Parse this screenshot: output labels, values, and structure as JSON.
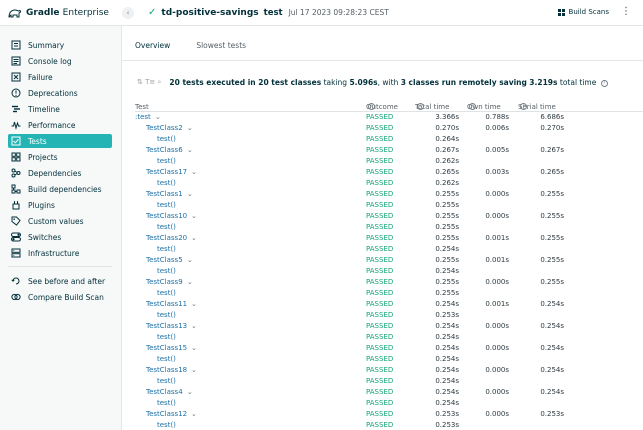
{
  "header": {
    "brand_bold": "Gradle",
    "brand_light": "Enterprise",
    "project": "td-positive-savings",
    "task": "test",
    "date": "Jul 17 2023 09:28:23 CEST",
    "build_scans_label": "Build Scans"
  },
  "sidebar": {
    "items": [
      {
        "label": "Summary",
        "icon": "summary-icon"
      },
      {
        "label": "Console log",
        "icon": "console-icon"
      },
      {
        "label": "Failure",
        "icon": "failure-icon"
      },
      {
        "label": "Deprecations",
        "icon": "deprecations-icon"
      },
      {
        "label": "Timeline",
        "icon": "timeline-icon"
      },
      {
        "label": "Performance",
        "icon": "performance-icon"
      },
      {
        "label": "Tests",
        "icon": "tests-icon"
      },
      {
        "label": "Projects",
        "icon": "projects-icon"
      },
      {
        "label": "Dependencies",
        "icon": "dependencies-icon"
      },
      {
        "label": "Build dependencies",
        "icon": "build-dependencies-icon"
      },
      {
        "label": "Plugins",
        "icon": "plugins-icon"
      },
      {
        "label": "Custom values",
        "icon": "custom-values-icon"
      },
      {
        "label": "Switches",
        "icon": "switches-icon"
      },
      {
        "label": "Infrastructure",
        "icon": "infrastructure-icon"
      }
    ],
    "active_item": "Tests",
    "secondary": [
      {
        "label": "See before and after",
        "icon": "before-after-icon"
      },
      {
        "label": "Compare Build Scan",
        "icon": "compare-icon"
      }
    ]
  },
  "tabs": [
    {
      "label": "Overview",
      "active": true
    },
    {
      "label": "Slowest tests",
      "active": false
    }
  ],
  "summary": {
    "count_text": "20 tests executed in 20 test classes",
    "taking_word": "taking",
    "duration": "5.096s",
    "with_word": ", with",
    "classes_text": "3 classes run remotely saving",
    "saving": "3.219s",
    "total_word": "total time"
  },
  "table": {
    "columns": [
      "Test",
      "Outcome",
      "Total time",
      "Own time",
      "Serial time"
    ],
    "rows": [
      {
        "name": ":test",
        "level": 0,
        "expand": true,
        "outcome": "PASSED",
        "total": "3.366s",
        "own": "0.788s",
        "serial": "6.686s"
      },
      {
        "name": "TestClass2",
        "level": 1,
        "expand": true,
        "outcome": "PASSED",
        "total": "0.270s",
        "own": "0.006s",
        "serial": "0.270s"
      },
      {
        "name": "test()",
        "level": 2,
        "expand": false,
        "outcome": "PASSED",
        "total": "0.264s",
        "own": "",
        "serial": ""
      },
      {
        "name": "TestClass6",
        "level": 1,
        "expand": true,
        "outcome": "PASSED",
        "total": "0.267s",
        "own": "0.005s",
        "serial": "0.267s"
      },
      {
        "name": "test()",
        "level": 2,
        "expand": false,
        "outcome": "PASSED",
        "total": "0.262s",
        "own": "",
        "serial": ""
      },
      {
        "name": "TestClass17",
        "level": 1,
        "expand": true,
        "outcome": "PASSED",
        "total": "0.265s",
        "own": "0.003s",
        "serial": "0.265s"
      },
      {
        "name": "test()",
        "level": 2,
        "expand": false,
        "outcome": "PASSED",
        "total": "0.262s",
        "own": "",
        "serial": ""
      },
      {
        "name": "TestClass1",
        "level": 1,
        "expand": true,
        "outcome": "PASSED",
        "total": "0.255s",
        "own": "0.000s",
        "serial": "0.255s"
      },
      {
        "name": "test()",
        "level": 2,
        "expand": false,
        "outcome": "PASSED",
        "total": "0.255s",
        "own": "",
        "serial": ""
      },
      {
        "name": "TestClass10",
        "level": 1,
        "expand": true,
        "outcome": "PASSED",
        "total": "0.255s",
        "own": "0.000s",
        "serial": "0.255s"
      },
      {
        "name": "test()",
        "level": 2,
        "expand": false,
        "outcome": "PASSED",
        "total": "0.255s",
        "own": "",
        "serial": ""
      },
      {
        "name": "TestClass20",
        "level": 1,
        "expand": true,
        "outcome": "PASSED",
        "total": "0.255s",
        "own": "0.001s",
        "serial": "0.255s"
      },
      {
        "name": "test()",
        "level": 2,
        "expand": false,
        "outcome": "PASSED",
        "total": "0.254s",
        "own": "",
        "serial": ""
      },
      {
        "name": "TestClass5",
        "level": 1,
        "expand": true,
        "outcome": "PASSED",
        "total": "0.255s",
        "own": "0.001s",
        "serial": "0.255s"
      },
      {
        "name": "test()",
        "level": 2,
        "expand": false,
        "outcome": "PASSED",
        "total": "0.254s",
        "own": "",
        "serial": ""
      },
      {
        "name": "TestClass9",
        "level": 1,
        "expand": true,
        "outcome": "PASSED",
        "total": "0.255s",
        "own": "0.000s",
        "serial": "0.255s"
      },
      {
        "name": "test()",
        "level": 2,
        "expand": false,
        "outcome": "PASSED",
        "total": "0.255s",
        "own": "",
        "serial": ""
      },
      {
        "name": "TestClass11",
        "level": 1,
        "expand": true,
        "outcome": "PASSED",
        "total": "0.254s",
        "own": "0.001s",
        "serial": "0.254s"
      },
      {
        "name": "test()",
        "level": 2,
        "expand": false,
        "outcome": "PASSED",
        "total": "0.253s",
        "own": "",
        "serial": ""
      },
      {
        "name": "TestClass13",
        "level": 1,
        "expand": true,
        "outcome": "PASSED",
        "total": "0.254s",
        "own": "0.000s",
        "serial": "0.254s"
      },
      {
        "name": "test()",
        "level": 2,
        "expand": false,
        "outcome": "PASSED",
        "total": "0.254s",
        "own": "",
        "serial": ""
      },
      {
        "name": "TestClass15",
        "level": 1,
        "expand": true,
        "outcome": "PASSED",
        "total": "0.254s",
        "own": "0.000s",
        "serial": "0.254s"
      },
      {
        "name": "test()",
        "level": 2,
        "expand": false,
        "outcome": "PASSED",
        "total": "0.254s",
        "own": "",
        "serial": ""
      },
      {
        "name": "TestClass18",
        "level": 1,
        "expand": true,
        "outcome": "PASSED",
        "total": "0.254s",
        "own": "0.000s",
        "serial": "0.254s"
      },
      {
        "name": "test()",
        "level": 2,
        "expand": false,
        "outcome": "PASSED",
        "total": "0.254s",
        "own": "",
        "serial": ""
      },
      {
        "name": "TestClass4",
        "level": 1,
        "expand": true,
        "outcome": "PASSED",
        "total": "0.254s",
        "own": "0.000s",
        "serial": "0.254s"
      },
      {
        "name": "test()",
        "level": 2,
        "expand": false,
        "outcome": "PASSED",
        "total": "0.254s",
        "own": "",
        "serial": ""
      },
      {
        "name": "TestClass12",
        "level": 1,
        "expand": true,
        "outcome": "PASSED",
        "total": "0.253s",
        "own": "0.000s",
        "serial": "0.253s"
      },
      {
        "name": "test()",
        "level": 2,
        "expand": false,
        "outcome": "PASSED",
        "total": "0.253s",
        "own": "",
        "serial": ""
      }
    ]
  },
  "colors": {
    "accent": "#24b4b4",
    "passed": "#11a377",
    "link": "#1a6fa6",
    "brand_dark": "#02303a"
  }
}
